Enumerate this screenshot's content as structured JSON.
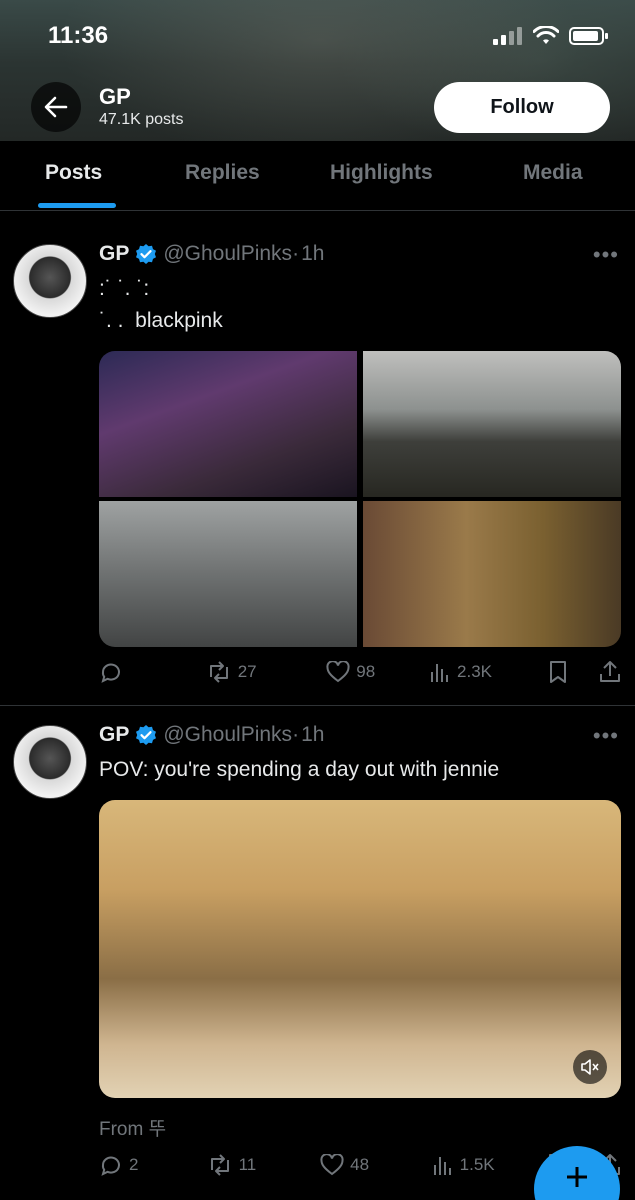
{
  "status_bar": {
    "time": "11:36"
  },
  "profile_header": {
    "name": "GP",
    "posts_count": "47.1K posts",
    "follow_label": "Follow"
  },
  "tabs": [
    {
      "label": "Posts",
      "active": true
    },
    {
      "label": "Replies"
    },
    {
      "label": "Highlights"
    },
    {
      "label": "Media"
    }
  ],
  "posts": [
    {
      "author_name": "GP",
      "handle": "@GhoulPinks",
      "separator": "·",
      "time": "1h",
      "text_line1": ":˙ ˙. ˙:",
      "text_line2": "˙. .  blackpink",
      "media": "photo-grid-4",
      "actions": {
        "replies": "",
        "reposts": "27",
        "likes": "98",
        "views": "2.3K"
      }
    },
    {
      "author_name": "GP",
      "handle": "@GhoulPinks",
      "separator": "·",
      "time": "1h",
      "text": "POV: you're spending a day out with jennie",
      "media": "video",
      "from_label": "From 뚜",
      "actions": {
        "replies": "2",
        "reposts": "11",
        "likes": "48",
        "views": "1.5K"
      }
    }
  ],
  "colors": {
    "accent": "#1d9bf0",
    "background": "#000000",
    "muted": "#71767b"
  }
}
